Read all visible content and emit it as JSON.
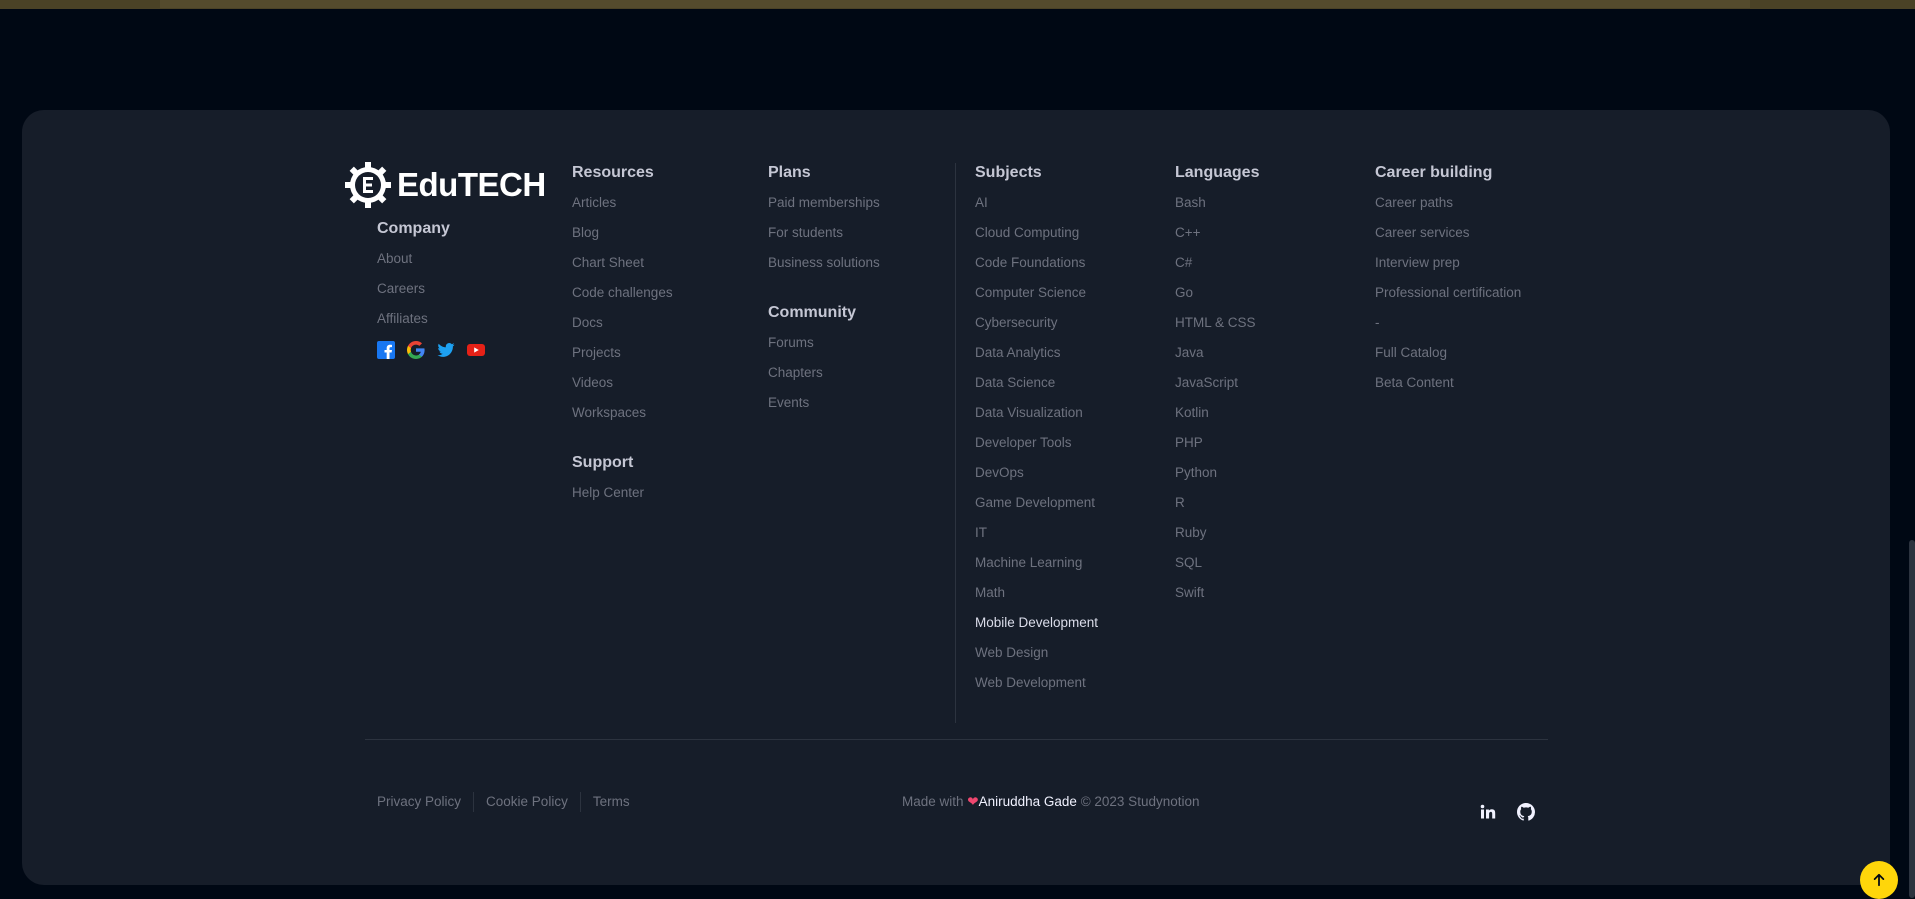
{
  "brand": {
    "name": "EduTECH"
  },
  "company": {
    "title": "Company",
    "items": [
      "About",
      "Careers",
      "Affiliates"
    ]
  },
  "social_icons": [
    "facebook-icon",
    "google-icon",
    "twitter-icon",
    "youtube-icon"
  ],
  "resources": {
    "title": "Resources",
    "items": [
      "Articles",
      "Blog",
      "Chart Sheet",
      "Code challenges",
      "Docs",
      "Projects",
      "Videos",
      "Workspaces"
    ]
  },
  "support": {
    "title": "Support",
    "items": [
      "Help Center"
    ]
  },
  "plans": {
    "title": "Plans",
    "items": [
      "Paid memberships",
      "For students",
      "Business solutions"
    ]
  },
  "community": {
    "title": "Community",
    "items": [
      "Forums",
      "Chapters",
      "Events"
    ]
  },
  "subjects": {
    "title": "Subjects",
    "items": [
      "AI",
      "Cloud Computing",
      "Code Foundations",
      "Computer Science",
      "Cybersecurity",
      "Data Analytics",
      "Data Science",
      "Data Visualization",
      "Developer Tools",
      "DevOps",
      "Game Development",
      "IT",
      "Machine Learning",
      "Math",
      "Mobile Development",
      "Web Design",
      "Web Development"
    ],
    "active_item": "Mobile Development"
  },
  "languages": {
    "title": "Languages",
    "items": [
      "Bash",
      "C++",
      "C#",
      "Go",
      "HTML & CSS",
      "Java",
      "JavaScript",
      "Kotlin",
      "PHP",
      "Python",
      "R",
      "Ruby",
      "SQL",
      "Swift"
    ]
  },
  "career": {
    "title": "Career building",
    "items": [
      "Career paths",
      "Career services",
      "Interview prep",
      "Professional certification",
      "-",
      "Full Catalog",
      "Beta Content"
    ]
  },
  "bottom": {
    "links": [
      "Privacy Policy",
      "Cookie Policy",
      "Terms"
    ],
    "made_prefix": "Made with",
    "author": "Aniruddha Gade",
    "suffix": "© 2023 Studynotion"
  },
  "right_icons": [
    "linkedin-icon",
    "github-icon"
  ],
  "colors": {
    "background": "#000814",
    "footer": "#161d29",
    "accent": "#ffd60a",
    "heart": "#ef476f"
  }
}
